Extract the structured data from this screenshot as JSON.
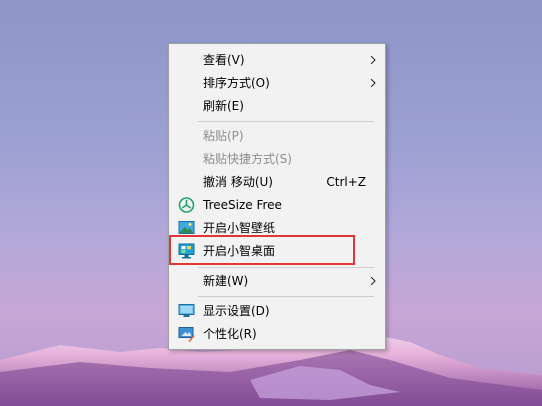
{
  "menu": {
    "items": [
      {
        "label": "查看(V)"
      },
      {
        "label": "排序方式(O)"
      },
      {
        "label": "刷新(E)"
      },
      {
        "label": "粘贴(P)"
      },
      {
        "label": "粘贴快捷方式(S)"
      },
      {
        "label": "撤消 移动(U)",
        "shortcut": "Ctrl+Z"
      },
      {
        "label": "TreeSize Free",
        "icon": "treesize-icon"
      },
      {
        "label": "开启小智壁纸",
        "icon": "wallpaper-icon"
      },
      {
        "label": "开启小智桌面",
        "icon": "desktop-app-icon"
      },
      {
        "label": "新建(W)"
      },
      {
        "label": "显示设置(D)",
        "icon": "display-icon"
      },
      {
        "label": "个性化(R)",
        "icon": "personalize-icon"
      }
    ]
  },
  "colors": {
    "menu_bg": "#f2f2f2",
    "disabled_text": "#8d8d8d",
    "highlight_box": "#e2353a"
  }
}
